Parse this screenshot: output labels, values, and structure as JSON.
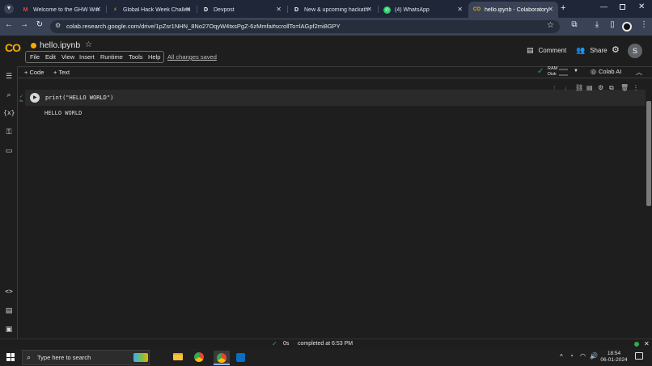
{
  "browser": {
    "tabs": [
      {
        "title": "Welcome to the GHW Win",
        "icon": "gmail-icon"
      },
      {
        "title": "Global Hack Week Challen",
        "icon": "bolt-icon"
      },
      {
        "title": "Devpost",
        "icon": "devpost-icon"
      },
      {
        "title": "New & upcoming hackath",
        "icon": "devpost-icon"
      },
      {
        "title": "(4) WhatsApp",
        "icon": "whatsapp-icon"
      },
      {
        "title": "hello.ipynb - Colaboratory",
        "icon": "colab-icon",
        "active": true
      }
    ],
    "url": "colab.research.google.com/drive/1pZsr1NHN_8No27OqyW4txsPgZ-6zMmfa#scrollTo=lAGpf2mi8GPY",
    "favicon_letters": {
      "devpost": "D"
    }
  },
  "colab": {
    "logo": "CO",
    "notebook_title": "hello.ipynb",
    "menu": [
      "File",
      "Edit",
      "View",
      "Insert",
      "Runtime",
      "Tools",
      "Help"
    ],
    "save_status": "All changes saved",
    "comment_label": "Comment",
    "share_label": "Share",
    "avatar_letter": "S",
    "add_code": "+ Code",
    "add_text": "+ Text",
    "ram_label": "RAM",
    "disk_label": "Disk",
    "colab_ai": "Colab AI",
    "cell": {
      "code": "print(\"HELLO WORLD\")",
      "output": "HELLO WORLD",
      "exec_marker": "0s"
    },
    "status": {
      "time": "0s",
      "message": "completed at 6:53 PM"
    }
  },
  "taskbar": {
    "search_placeholder": "Type here to search",
    "time": "18:54",
    "date": "06-01-2024"
  },
  "colors": {
    "accent_orange": "#f9ab00",
    "status_green": "#34a853",
    "tab_bg": "#1f2637",
    "active_tab_bg": "#3a4356"
  }
}
